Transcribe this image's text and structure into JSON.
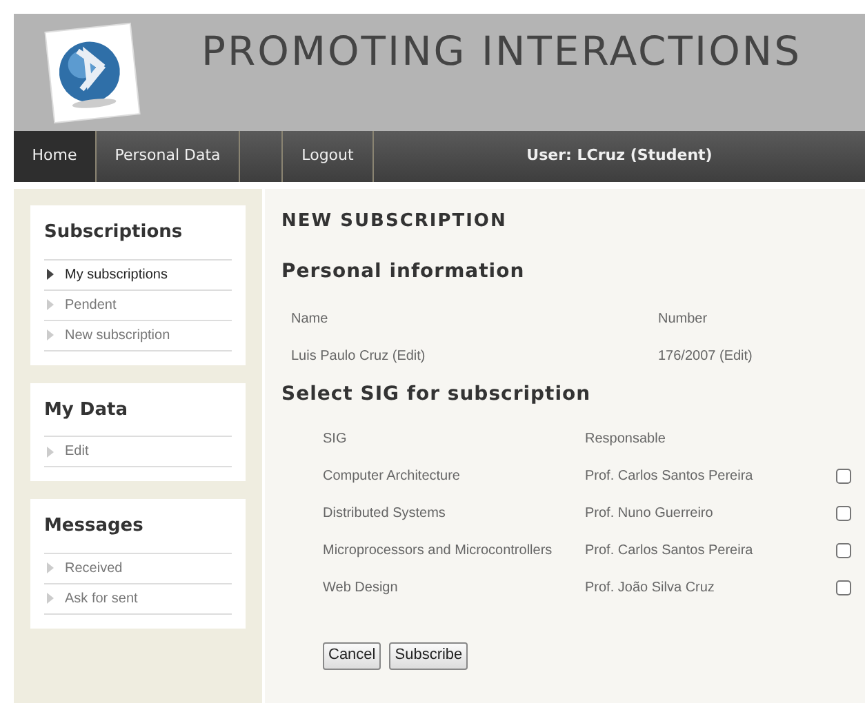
{
  "header": {
    "title": "PROMOTING INTERACTIONS"
  },
  "nav": {
    "items": [
      {
        "label": "Home",
        "selected": true
      },
      {
        "label": "Personal Data",
        "selected": false
      },
      {
        "label": "Logout",
        "selected": false
      }
    ],
    "user": "User: LCruz (Student)"
  },
  "sidebar": [
    {
      "title": "Subscriptions",
      "items": [
        {
          "label": "My subscriptions",
          "selected": true
        },
        {
          "label": "Pendent",
          "selected": false
        },
        {
          "label": "New subscription",
          "selected": false
        }
      ]
    },
    {
      "title": "My Data",
      "items": [
        {
          "label": "Edit",
          "selected": false
        }
      ]
    },
    {
      "title": "Messages",
      "items": [
        {
          "label": "Received",
          "selected": false
        },
        {
          "label": "Ask for sent",
          "selected": false
        }
      ]
    }
  ],
  "main": {
    "title": "NEW SUBSCRIPTION",
    "personal_heading": "Personal information",
    "personal": {
      "columns": [
        "Name",
        "Number"
      ],
      "values": [
        "Luis Paulo Cruz (Edit)",
        "176/2007 (Edit)"
      ]
    },
    "sig_heading": "Select SIG for subscription",
    "sig_table": {
      "columns": [
        "SIG",
        "Responsable"
      ],
      "rows": [
        {
          "sig": "Computer Architecture",
          "responsable": "Prof. Carlos Santos Pereira",
          "checked": false
        },
        {
          "sig": "Distributed Systems",
          "responsable": "Prof. Nuno Guerreiro",
          "checked": false
        },
        {
          "sig": "Microprocessors and Microcontrollers",
          "responsable": "Prof. Carlos Santos Pereira",
          "checked": false
        },
        {
          "sig": "Web Design",
          "responsable": "Prof. João Silva Cruz",
          "checked": false
        }
      ]
    },
    "buttons": [
      "Cancel",
      "Subscribe"
    ]
  }
}
